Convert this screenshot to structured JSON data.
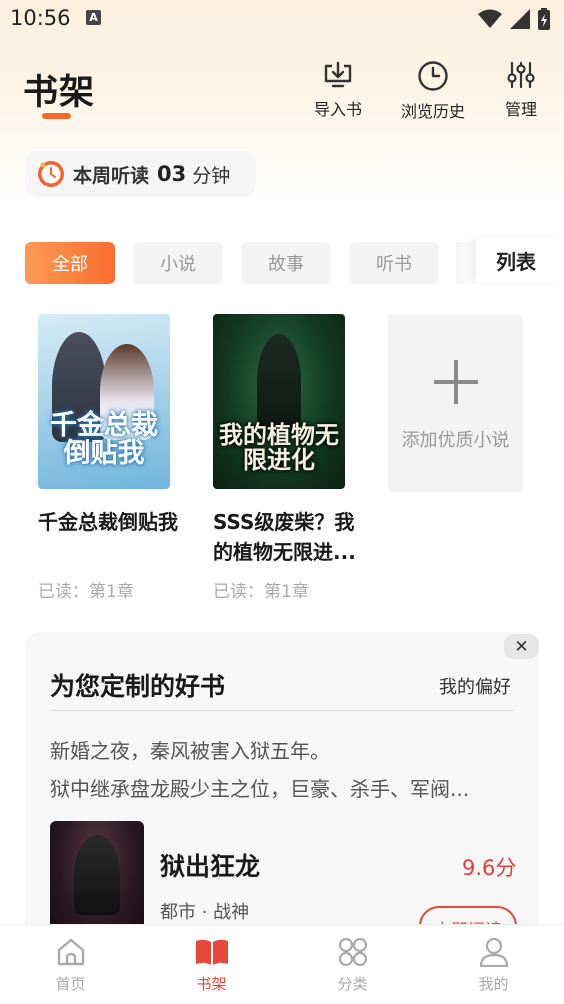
{
  "status_bar": {
    "time": "10:56"
  },
  "header": {
    "title": "书架",
    "actions": [
      {
        "icon": "import-icon",
        "label": "导入书"
      },
      {
        "icon": "history-clock-icon",
        "label": "浏览历史"
      },
      {
        "icon": "sliders-icon",
        "label": "管理"
      }
    ]
  },
  "weekly_listen": {
    "label": "本周听读",
    "value": "03",
    "unit": "分钟"
  },
  "tabs": [
    {
      "label": "全部",
      "active": true
    },
    {
      "label": "小说",
      "active": false
    },
    {
      "label": "故事",
      "active": false
    },
    {
      "label": "听书",
      "active": false
    }
  ],
  "view_toggle": {
    "label": "列表"
  },
  "books": [
    {
      "title": "千金总裁倒贴我",
      "progress": "已读：第1章",
      "cover_text": "千金总裁倒贴我"
    },
    {
      "title": "SSS级废柴？我的植物无限进...",
      "progress": "已读：第1章",
      "cover_text": "我的植物无限进化"
    }
  ],
  "add_book": {
    "label": "添加优质小说"
  },
  "recommendation": {
    "title": "为您定制的好书",
    "preference_link": "我的偏好",
    "close": "✕",
    "description": [
      "新婚之夜，秦风被害入狱五年。",
      "狱中继承盘龙殿少主之位，巨豪、杀手、军阀..."
    ],
    "book": {
      "title": "狱出狂龙",
      "score": "9.6分",
      "tags": "都市 · 战神",
      "button": "立即阅读"
    }
  },
  "bottom_nav": [
    {
      "icon": "home-icon",
      "label": "首页",
      "active": false
    },
    {
      "icon": "book-icon",
      "label": "书架",
      "active": true
    },
    {
      "icon": "category-icon",
      "label": "分类",
      "active": false
    },
    {
      "icon": "profile-icon",
      "label": "我的",
      "active": false
    }
  ],
  "colors": {
    "accent": "#f26b2b",
    "red": "#e8483a"
  }
}
